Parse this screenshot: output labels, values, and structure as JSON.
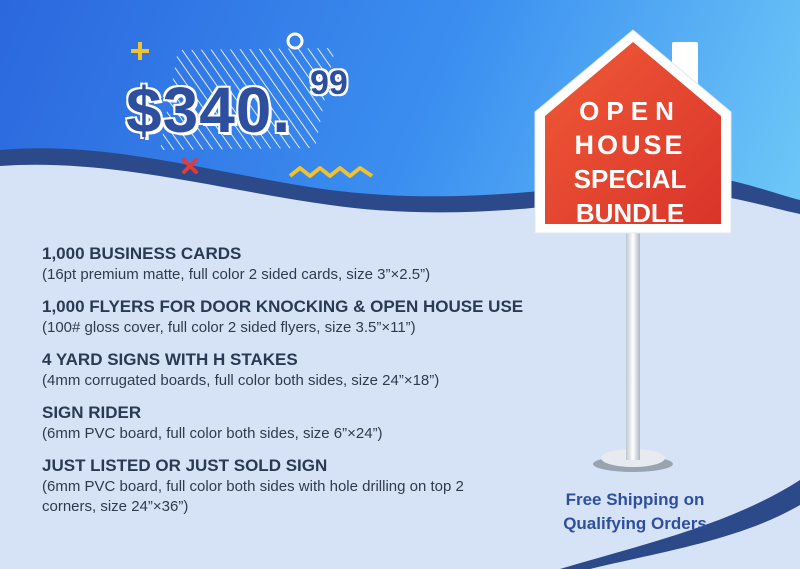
{
  "price": {
    "main": "$340.",
    "cents": "99"
  },
  "sign": {
    "line1": "OPEN",
    "line2": "HOUSE",
    "line3": "SPECIAL",
    "line4": "BUNDLE"
  },
  "items": [
    {
      "title": "1,000 BUSINESS CARDS",
      "desc": "(16pt premium matte, full color 2 sided cards, size 3”×2.5”)"
    },
    {
      "title": "1,000 FLYERS FOR DOOR KNOCKING  & OPEN HOUSE USE",
      "desc": "(100# gloss cover, full color 2 sided flyers, size 3.5”×11”)"
    },
    {
      "title": "4 YARD SIGNS WITH H STAKES",
      "desc": "(4mm corrugated boards, full color both sides, size 24”×18”)"
    },
    {
      "title": "SIGN RIDER",
      "desc": "(6mm PVC board, full color both sides, size 6”×24”)"
    },
    {
      "title": "JUST LISTED OR JUST SOLD SIGN",
      "desc": "(6mm PVC board, full color both sides with hole drilling on top 2 corners, size 24”×36”)"
    }
  ],
  "shipping": {
    "line1": "Free Shipping on",
    "line2": "Qualifying Orders"
  },
  "colors": {
    "blue_top": "#2f6fe0",
    "blue_light": "#5fb8f5",
    "navy_wave": "#2c4a8a",
    "pale_bg": "#d6e3f7",
    "sign_red": "#e8432e",
    "text_dark": "#2a3a52",
    "accent_yellow": "#f2c12e",
    "accent_red": "#e23b3b"
  },
  "icons": [
    "plus-icon",
    "circle-icon",
    "x-mark-icon",
    "zigzag-icon",
    "house-sign-icon"
  ]
}
